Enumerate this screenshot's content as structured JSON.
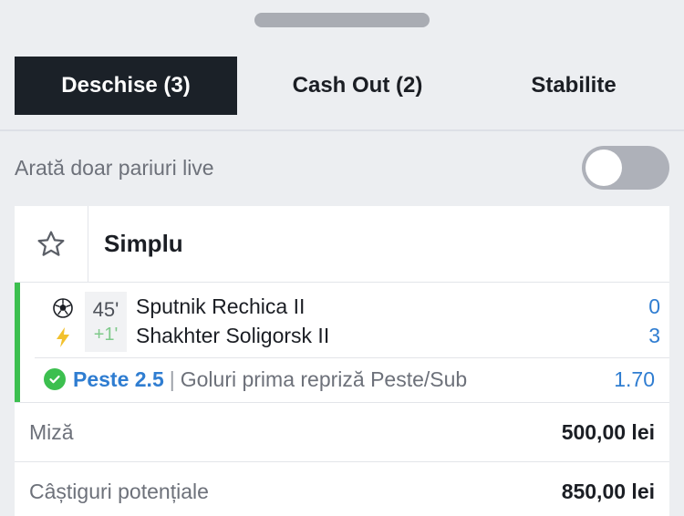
{
  "tabs": [
    {
      "label": "Deschise (3)",
      "active": true
    },
    {
      "label": "Cash Out (2)",
      "active": false
    },
    {
      "label": "Stabilite",
      "active": false
    }
  ],
  "live_filter": {
    "label": "Arată doar pariuri live",
    "enabled": false
  },
  "bet": {
    "type": "Simplu",
    "match": {
      "minute": "45'",
      "added_time": "+1'",
      "home": {
        "name": "Sputnik Rechica II",
        "score": "0"
      },
      "away": {
        "name": "Shakhter Soligorsk II",
        "score": "3"
      }
    },
    "selection": {
      "pick": "Peste 2.5",
      "separator": "|",
      "market": "Goluri prima repriză Peste/Sub",
      "odds": "1.70"
    },
    "stake": {
      "label": "Miză",
      "value": "500,00 lei"
    },
    "potential": {
      "label": "Câștiguri potențiale",
      "value": "850,00 lei"
    }
  },
  "icons": {
    "favorite": "star-outline-icon",
    "sport": "soccer-ball-icon",
    "live": "lightning-bolt-icon",
    "won": "check-circle-icon"
  },
  "colors": {
    "accent_blue": "#2f7dd1",
    "live_green": "#3cbf4f",
    "tab_active_bg": "#1b2128",
    "bolt_yellow": "#f2c12e"
  }
}
